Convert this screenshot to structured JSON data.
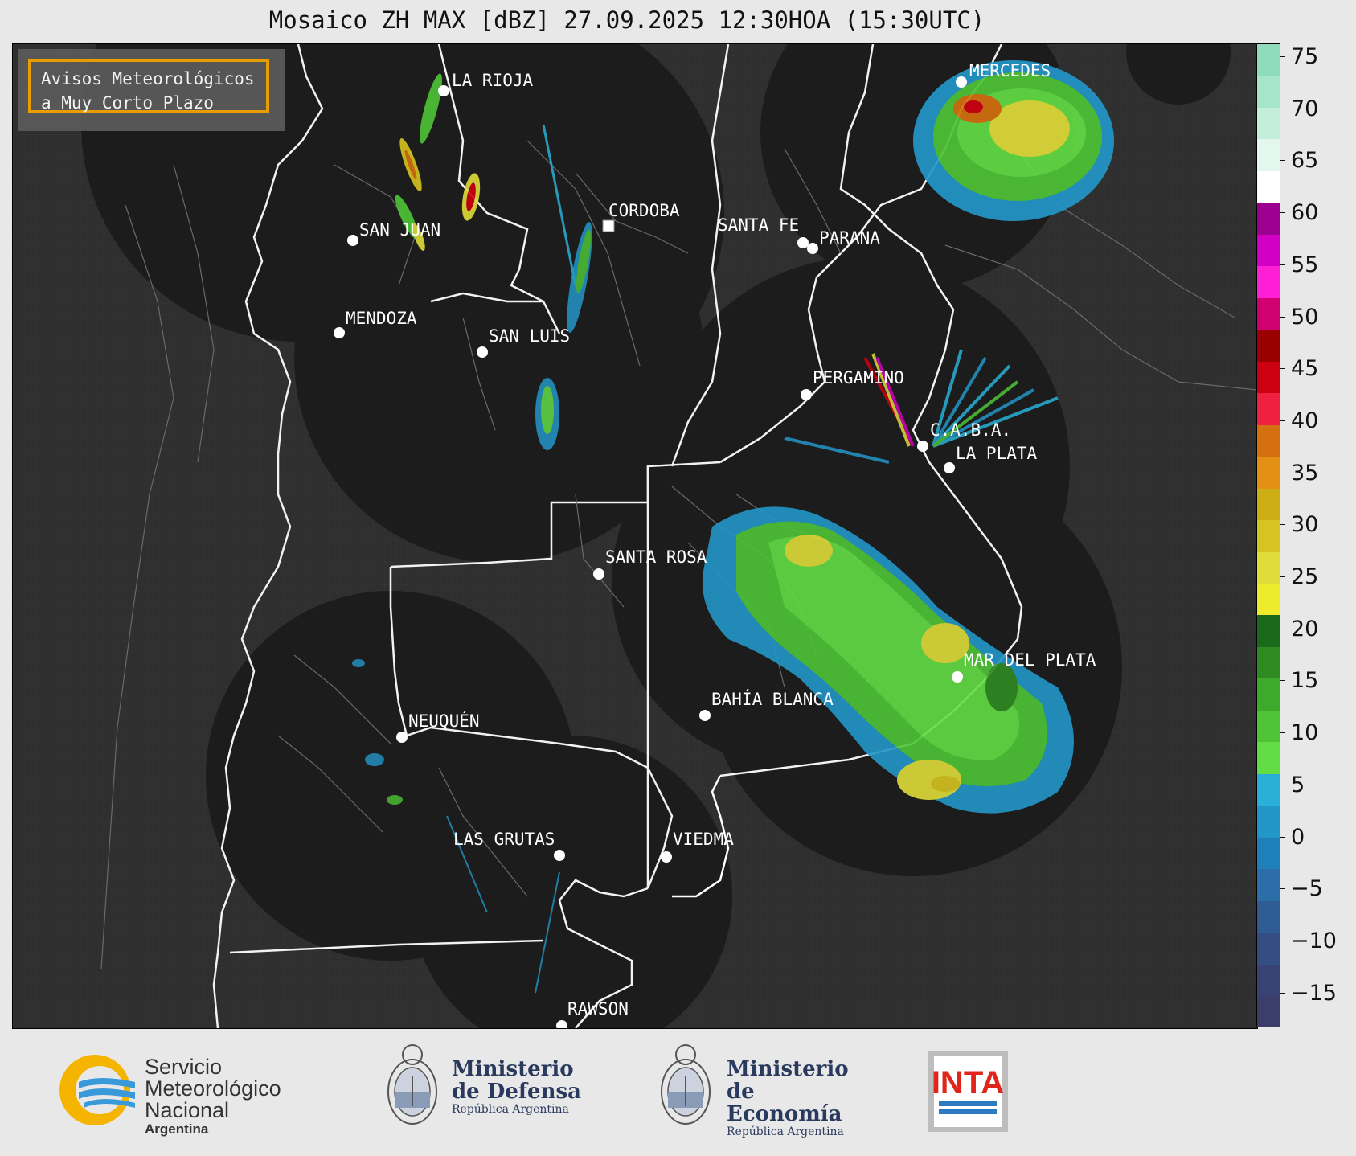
{
  "title": "Mosaico ZH MAX [dBZ] 27.09.2025 12:30HOA (15:30UTC)",
  "badge": {
    "line1": "Avisos Meteorológicos",
    "line2": "a Muy Corto Plazo",
    "accent": "#f5a300"
  },
  "cities": [
    {
      "name": "LA RIOJA"
    },
    {
      "name": "SAN JUAN"
    },
    {
      "name": "CORDOBA"
    },
    {
      "name": "SANTA FE"
    },
    {
      "name": "PARANA"
    },
    {
      "name": "MERCEDES"
    },
    {
      "name": "MENDOZA"
    },
    {
      "name": "SAN LUIS"
    },
    {
      "name": "PERGAMINO"
    },
    {
      "name": "C.A.B.A."
    },
    {
      "name": "LA PLATA"
    },
    {
      "name": "SANTA ROSA"
    },
    {
      "name": "MAR DEL PLATA"
    },
    {
      "name": "BAHÍA BLANCA"
    },
    {
      "name": "NEUQUÉN"
    },
    {
      "name": "LAS GRUTAS"
    },
    {
      "name": "VIEDMA"
    },
    {
      "name": "RAWSON"
    }
  ],
  "colorbar": {
    "unit": "dBZ",
    "ticks": [
      "75",
      "70",
      "65",
      "60",
      "55",
      "50",
      "45",
      "40",
      "35",
      "30",
      "25",
      "20",
      "15",
      "10",
      "5",
      "0",
      "−5",
      "−10",
      "−15"
    ],
    "colors": [
      "#8fdcbc",
      "#a6e6c8",
      "#c3efda",
      "#e4f7ee",
      "#ffffff",
      "#9b008f",
      "#d100c4",
      "#ff1fd4",
      "#d10070",
      "#9a0000",
      "#cc0010",
      "#f02040",
      "#d4700f",
      "#e39015",
      "#cdae14",
      "#d6c520",
      "#e0dc3a",
      "#eeea2c",
      "#1b6a1b",
      "#2e8b22",
      "#3eaa2c",
      "#4ec436",
      "#62dd44",
      "#2ab0d8",
      "#2396c8",
      "#1f7fb8",
      "#2b6ea8",
      "#305c94",
      "#344e84",
      "#384373",
      "#3a3e68"
    ]
  },
  "logos": {
    "smn": {
      "line1": "Servicio",
      "line2": "Meteorológico",
      "line3": "Nacional",
      "sub": "Argentina"
    },
    "defensa": {
      "line1": "Ministerio",
      "line2": "de Defensa",
      "sub": "República Argentina"
    },
    "economia": {
      "line1": "Ministerio",
      "line2": "de Economía",
      "sub": "República Argentina"
    },
    "inta": {
      "text": "INTA"
    }
  }
}
